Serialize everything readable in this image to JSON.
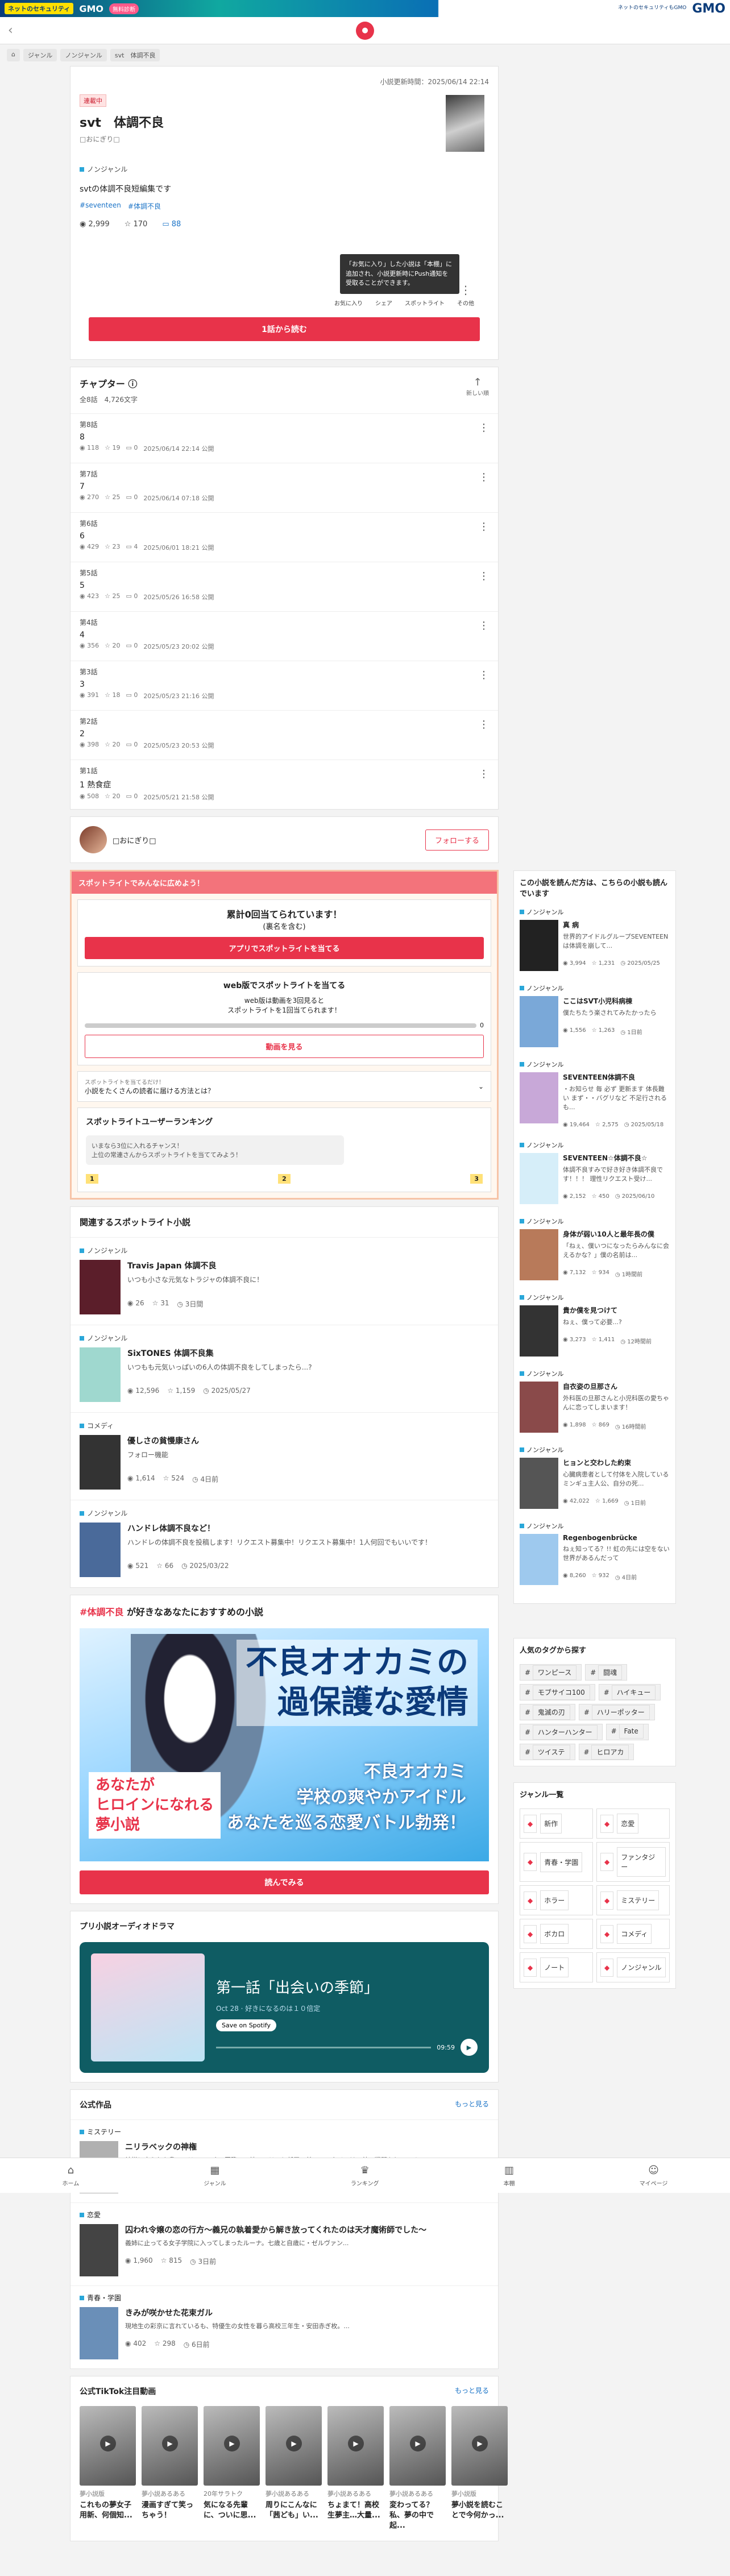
{
  "topbar": {
    "badge": "ネットのセキュリティ",
    "brand": "GMO",
    "pill": "無料診断",
    "right_small": "ネットのセキュリティもGMO",
    "right_brand": "GMO"
  },
  "header": {
    "logo": "●"
  },
  "breadcrumb": [
    "⌂",
    "ジャンル",
    "ノンジャンル",
    "svt　体調不良"
  ],
  "novel": {
    "updated": "小説更新時間：2025/06/14 22:14",
    "label": "連載中",
    "title": "svt　体調不良",
    "author": "□おにぎり□",
    "genre": "ノンジャンル",
    "description": "svtの体調不良短編集です",
    "tags": [
      "seventeen",
      "体調不良"
    ],
    "views": "2,999",
    "likes": "170",
    "comments": "88",
    "tooltip": "「お気に入り」した小説は「本棚」に追加され、小説更新時にPush通知を受取ることができます。",
    "actions": [
      "お気に入り",
      "シェア",
      "スポットライト",
      "その他"
    ],
    "read_button": "1話から読む"
  },
  "chapters": {
    "title": "チャプター",
    "summary": "全8話　4,726文字",
    "sort_label": "新しい順",
    "items": [
      {
        "num": "第8話",
        "title": "8",
        "views": "118",
        "likes": "19",
        "comments": "0",
        "date": "2025/06/14 22:14 公開"
      },
      {
        "num": "第7話",
        "title": "7",
        "views": "270",
        "likes": "25",
        "comments": "0",
        "date": "2025/06/14 07:18 公開"
      },
      {
        "num": "第6話",
        "title": "6",
        "views": "429",
        "likes": "23",
        "comments": "4",
        "date": "2025/06/01 18:21 公開"
      },
      {
        "num": "第5話",
        "title": "5",
        "views": "423",
        "likes": "25",
        "comments": "0",
        "date": "2025/05/26 16:58 公開"
      },
      {
        "num": "第4話",
        "title": "4",
        "views": "356",
        "likes": "20",
        "comments": "0",
        "date": "2025/05/23 20:02 公開"
      },
      {
        "num": "第3話",
        "title": "3",
        "views": "391",
        "likes": "18",
        "comments": "0",
        "date": "2025/05/23 21:16 公開"
      },
      {
        "num": "第2話",
        "title": "2",
        "views": "398",
        "likes": "20",
        "comments": "0",
        "date": "2025/05/23 20:53 公開"
      },
      {
        "num": "第1話",
        "title": "1 熱食症",
        "views": "508",
        "likes": "20",
        "comments": "0",
        "date": "2025/05/21 21:58 公開"
      }
    ]
  },
  "author_row": {
    "name": "□おにぎり□",
    "follow": "フォローする"
  },
  "spotlight": {
    "header": "スポットライトでみんなに広めよう！",
    "current": "累計0回当てられています！",
    "current_sub": "(裏名を含む)",
    "app_button": "アプリでスポットライトを当てる",
    "web_title": "web版でスポットライトを当てる",
    "web_desc": "web版は動画を3回見ると\nスポットライトを1回当てられます！",
    "web_count": "0",
    "web_progress_ratio": 0,
    "video_button": "動画を見る",
    "question_small": "スポットライトを当てるだけ！",
    "question": "小説をたくさんの読者に届ける方法とは？",
    "ranking_title": "スポットライトユーザーランキング",
    "ranking_bubble": "いまなら3位に入れるチャンス！\n上位の常連さんからスポットライトを当ててみよう！",
    "places": [
      "1",
      "2",
      "3"
    ]
  },
  "related": {
    "title": "関連するスポットライト小説",
    "items": [
      {
        "genre": "ノンジャンル",
        "title": "Travis Japan 体調不良",
        "desc": "いつも小さな元気なトラジャの体調不良に！",
        "views": "26",
        "likes": "31",
        "comments": "3日間",
        "color": "#5b1e2a"
      },
      {
        "genre": "ノンジャンル",
        "title": "SixTONES 体調不良集",
        "desc": "いつもも元気いっぱいの6人の体調不良をしてしまったら...?",
        "views": "12,596",
        "likes": "1,159",
        "comments": "2025/05/27",
        "color": "#9fd8cf"
      },
      {
        "genre": "コメディ",
        "title": "優しさの貧慢康さん",
        "desc": "フォロー機能",
        "views": "1,614",
        "likes": "524",
        "comments": "4日前",
        "color": "#333333"
      },
      {
        "genre": "ノンジャンル",
        "title": "ハンドレ体調不良など！",
        "desc": "ハンドレの体調不良を投稿します！リクエスト募集中！リクエスト募集中！1人何回でもいいです！",
        "views": "521",
        "likes": "66",
        "comments": "2025/03/22",
        "color": "#4a6a9a"
      }
    ]
  },
  "recommend": {
    "tag": "#体調不良",
    "title_rest": "が好きなあなたにおすすめの小説",
    "banner_title": "不良オオカミの\n過保護な愛情",
    "banner_sub": "不良オオカミ\n学校の爽やかアイドル\nあなたを巡る恋愛バトル勃発！",
    "banner_badge": "あなたが\nヒロインになれる\n夢小説",
    "button": "読んでみる"
  },
  "audio": {
    "title": "プリ小説オーディオドラマ",
    "episode": "第一話「出会いの季節」",
    "date": "Oct 28 · 好きになるのは１０倍定",
    "save": "Save on Spotify",
    "time": "09:59"
  },
  "official": {
    "title": "公式作品",
    "more": "もっと見る",
    "items": [
      {
        "genre": "ミステリー",
        "title": "ニリラベックの神権",
        "desc": "神様に守られた島・ニリラベック。国際での地。ソリーと任平の弟・アルタイルは、幼で戦闘をしているロレンツ...",
        "views": "",
        "likes": "",
        "comments": "",
        "color": "#b0b0b0"
      },
      {
        "genre": "恋愛",
        "title": "囚われ令嬢の恋の行方～義兄の執着愛から解き放ってくれたのは天才魔術師でした～",
        "desc": "義姉に止ってる女子学院に入ってしまったルーナ。七歳と自歳に・ゼルヴァン...",
        "views": "1,960",
        "likes": "815",
        "comments": "3日前",
        "color": "#444444"
      },
      {
        "genre": "青春・学園",
        "title": "きみが咲かせた花束ガル",
        "desc": "現地生の彩京に言れているも、特優生の女性を暮ら高校三年生・安田赤ぎ枚。...",
        "views": "402",
        "likes": "298",
        "comments": "6日前",
        "color": "#6a8fb8"
      }
    ]
  },
  "tiktok": {
    "title": "公式TikTok注目動画",
    "more": "もっと見る",
    "items": [
      {
        "cat": "夢小説版",
        "cap": "これもの夢女子用新、何個知..."
      },
      {
        "cat": "夢小説あるある",
        "cap": "漫画すぎて笑っちゃう！"
      },
      {
        "cat": "20年サラトク",
        "cap": "気になる先輩に、ついに思..."
      },
      {
        "cat": "夢小説あるある",
        "cap": "周りにこんなに「茜ども」い..."
      },
      {
        "cat": "夢小説あるある",
        "cap": "ちょまて！高校生夢主…大量..."
      },
      {
        "cat": "夢小説あるある",
        "cap": "変わってる？私、夢の中で起..."
      },
      {
        "cat": "夢小説版",
        "cap": "夢小説を読むことで今何かっ..."
      }
    ]
  },
  "bottom_nav": [
    "ホーム",
    "ジャンル",
    "ランキング",
    "本棚",
    "マイページ"
  ],
  "sidebar": {
    "readers_title": "この小説を読んだ方は、こちらの小説も読んでいます",
    "items": [
      {
        "genre": "ノンジャンル",
        "title": "真 病",
        "desc": "世界的アイドルグループSEVENTEENは体調を崩して...",
        "views": "3,994",
        "likes": "1,231",
        "date": "2025/05/25",
        "color": "#222222"
      },
      {
        "genre": "ノンジャンル",
        "title": "ここはSVT小児科病棟",
        "desc": "僕たちたう楽されてみたかったら",
        "views": "1,556",
        "likes": "1,263",
        "date": "1日前",
        "color": "#7aa8d8"
      },
      {
        "genre": "ノンジャンル",
        "title": "SEVENTEEN体調不良",
        "desc": "・お知らせ 毎 必ず 更新ます 体長難い まず・・バグリなど 不足行されるも...",
        "views": "19,464",
        "likes": "2,575",
        "date": "2025/05/18",
        "color": "#c8a8d8"
      },
      {
        "genre": "ノンジャンル",
        "title": "SEVENTEEN☆体調不良☆",
        "desc": "体調不良すみで好き好き体調不良です！！！ 理性リクエスト受け...",
        "views": "2,152",
        "likes": "450",
        "date": "2025/06/10",
        "color": "#d6eef9"
      },
      {
        "genre": "ノンジャンル",
        "title": "身体が弱い10人と最年長の僕",
        "desc": "「ねぇ、僕いつになったらみんなに会えるかな？」僕の名前は...",
        "views": "7,132",
        "likes": "934",
        "date": "1時間前",
        "color": "#b87a5a"
      },
      {
        "genre": "ノンジャンル",
        "title": "貴か僕を見つけて",
        "desc": "ねぇ、僕って必要...?",
        "views": "3,273",
        "likes": "1,411",
        "date": "12時間前",
        "color": "#333333"
      },
      {
        "genre": "ノンジャンル",
        "title": "自衣姿の旦那さん",
        "desc": "外科医の旦那さんと小児科医の愛ちゃんに恋ってしまいます！",
        "views": "1,898",
        "likes": "869",
        "date": "16時間前",
        "color": "#8a4a4a"
      },
      {
        "genre": "ノンジャンル",
        "title": "ヒョンと交わした約束",
        "desc": "心臓病患者として付体を入院しているミンギュ主人公、自分の死...",
        "views": "42,022",
        "likes": "1,669",
        "date": "1日前",
        "color": "#555555"
      },
      {
        "genre": "ノンジャンル",
        "title": "Regenbogenbrücke",
        "desc": "ねぇ知ってる？!! 虹の先には空をない世界があるんだって",
        "views": "8,260",
        "likes": "932",
        "date": "4日前",
        "color": "#9ec9ee"
      }
    ],
    "popular_tags_title": "人気のタグから探す",
    "popular_tags": [
      "ワンピース",
      "闘魂",
      "モブサイコ100",
      "ハイキュー",
      "鬼滅の刃",
      "ハリーポッター",
      "ハンターハンター",
      "Fate",
      "ツイステ",
      "ヒロアカ"
    ],
    "genre_title": "ジャンル一覧",
    "genres": [
      "新作",
      "恋愛",
      "青春・学園",
      "ファンタジー",
      "ホラー",
      "ミステリー",
      "ボカロ",
      "コメディ",
      "ノート",
      "ノンジャンル"
    ]
  },
  "colors": {
    "accent": "#e8334a",
    "link": "#1a73c7"
  }
}
